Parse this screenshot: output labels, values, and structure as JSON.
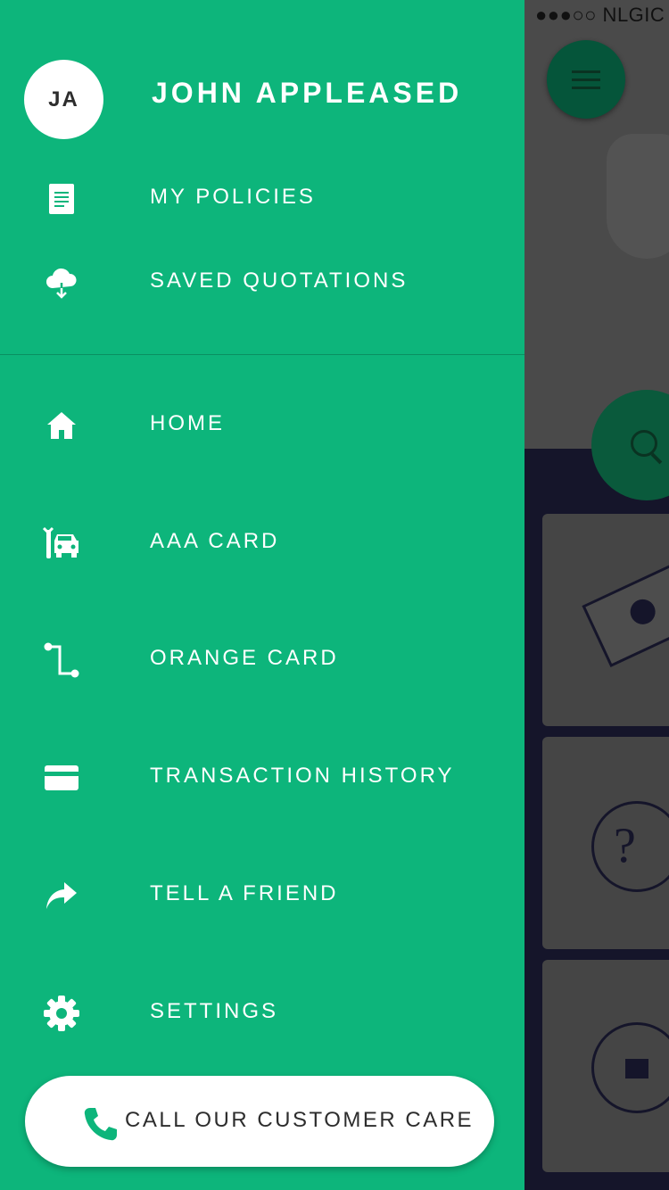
{
  "status_bar": {
    "carrier": "●●●○○ NLGIC"
  },
  "drawer": {
    "avatar_initials": "JA",
    "user_name": "JOHN APPLEASED",
    "account_items": [
      {
        "label": "MY POLICIES",
        "icon": "document-icon"
      },
      {
        "label": "SAVED QUOTATIONS",
        "icon": "cloud-download-icon"
      }
    ],
    "nav_items": [
      {
        "label": "HOME",
        "icon": "home-icon"
      },
      {
        "label": "AAA CARD",
        "icon": "car-repair-icon"
      },
      {
        "label": "ORANGE CARD",
        "icon": "route-icon"
      },
      {
        "label": "TRANSACTION HISTORY",
        "icon": "credit-card-icon"
      },
      {
        "label": "TELL A FRIEND",
        "icon": "share-arrow-icon"
      },
      {
        "label": "SETTINGS",
        "icon": "gear-icon"
      }
    ],
    "call_button": {
      "label": "CALL OUR CUSTOMER CARE",
      "icon": "phone-icon"
    }
  },
  "colors": {
    "drawer_bg": "#0db57b",
    "text": "#ffffff",
    "button_text": "#2d2d2d",
    "phone_icon": "#0db57b"
  }
}
